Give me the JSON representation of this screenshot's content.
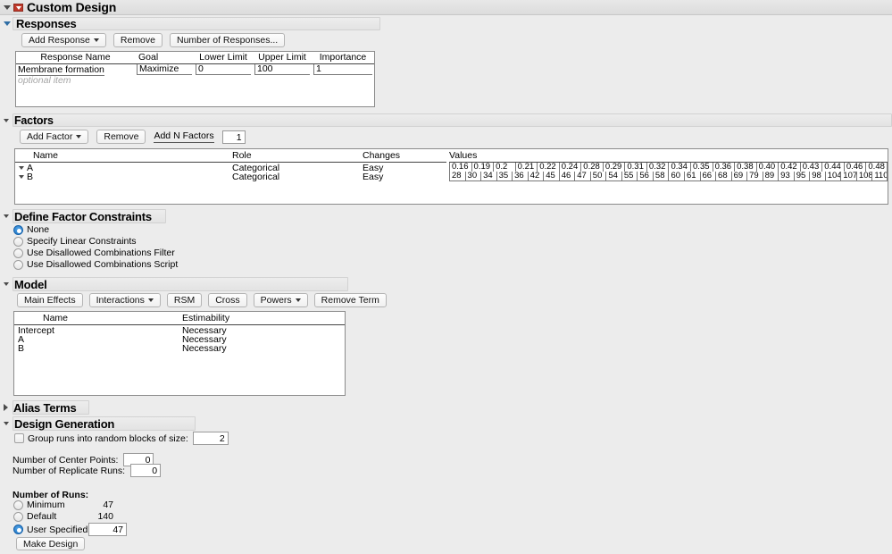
{
  "window": {
    "title": "Custom Design",
    "menu_icon": "red-triangle-menu-icon",
    "outline_icon": "disclosure-triangle-icon"
  },
  "responses": {
    "heading": "Responses",
    "buttons": {
      "add_response": "Add Response",
      "remove": "Remove",
      "number_of_responses": "Number of Responses..."
    },
    "columns": [
      "Response Name",
      "Goal",
      "Lower Limit",
      "Upper Limit",
      "Importance"
    ],
    "rows": [
      {
        "name": "Membrane formation",
        "goal": "Maximize",
        "lower_limit": "0",
        "upper_limit": "100",
        "importance": "1"
      }
    ],
    "optional_row": "optional item"
  },
  "factors": {
    "heading": "Factors",
    "buttons": {
      "add_factor": "Add Factor",
      "remove": "Remove",
      "add_n_factors": "Add N Factors"
    },
    "n_factors_value": "1",
    "columns": [
      "Name",
      "Role",
      "Changes",
      "Values"
    ],
    "rows": [
      {
        "name": "A",
        "role": "Categorical",
        "changes": "Easy",
        "values": [
          "0.16",
          "0.19",
          "0.2",
          "0.21",
          "0.22",
          "0.24",
          "0.28",
          "0.29",
          "0.31",
          "0.32",
          "0.34",
          "0.35",
          "0.36",
          "0.38",
          "0.40",
          "0.42",
          "0.43",
          "0.44",
          "0.46",
          "0.48"
        ]
      },
      {
        "name": "B",
        "role": "Categorical",
        "changes": "Easy",
        "values": [
          "28",
          "30",
          "34",
          "35",
          "36",
          "42",
          "45",
          "46",
          "47",
          "50",
          "54",
          "55",
          "56",
          "58",
          "60",
          "61",
          "66",
          "68",
          "69",
          "79",
          "89",
          "93",
          "95",
          "98",
          "104",
          "107",
          "108",
          "110"
        ]
      }
    ]
  },
  "constraints": {
    "heading": "Define Factor Constraints",
    "options": [
      {
        "label": "None",
        "selected": true
      },
      {
        "label": "Specify Linear Constraints",
        "selected": false
      },
      {
        "label": "Use Disallowed Combinations Filter",
        "selected": false
      },
      {
        "label": "Use Disallowed Combinations Script",
        "selected": false
      }
    ]
  },
  "model": {
    "heading": "Model",
    "buttons": {
      "main_effects": "Main Effects",
      "interactions": "Interactions",
      "rsm": "RSM",
      "cross": "Cross",
      "powers": "Powers",
      "remove_term": "Remove Term"
    },
    "columns": [
      "Name",
      "Estimability"
    ],
    "rows": [
      {
        "name": "Intercept",
        "estimability": "Necessary"
      },
      {
        "name": "A",
        "estimability": "Necessary"
      },
      {
        "name": "B",
        "estimability": "Necessary"
      }
    ]
  },
  "alias_terms": {
    "heading": "Alias Terms"
  },
  "design_generation": {
    "heading": "Design Generation",
    "group_runs_label": "Group runs into random blocks of size:",
    "group_runs_checked": false,
    "group_runs_value": "2",
    "center_points_label": "Number of Center Points:",
    "center_points_value": "0",
    "replicate_runs_label": "Number of Replicate Runs:",
    "replicate_runs_value": "0",
    "number_of_runs_label": "Number of Runs:",
    "run_options": [
      {
        "label": "Minimum",
        "value": "47",
        "selected": false
      },
      {
        "label": "Default",
        "value": "140",
        "selected": false
      },
      {
        "label": "User Specified",
        "value": "47",
        "selected": true
      }
    ],
    "make_design": "Make Design"
  },
  "colors": {
    "background": "#ececec",
    "accent": "#1b72c4",
    "menu_red": "#c0392b"
  }
}
